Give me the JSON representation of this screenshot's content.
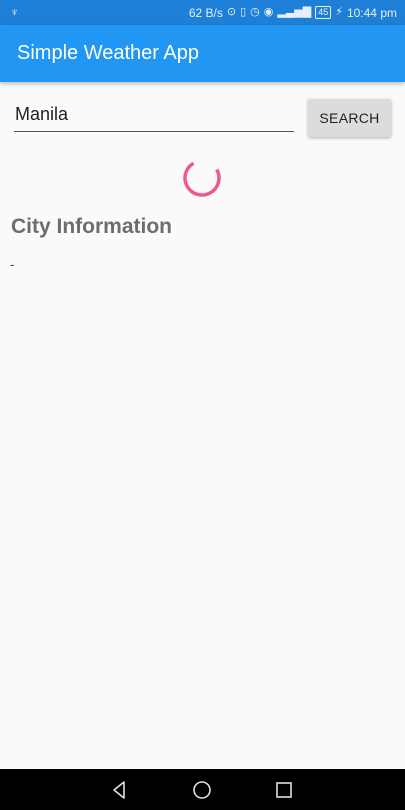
{
  "status_bar": {
    "left_icon": "usb-icon",
    "network_speed": "62 B/s",
    "battery_level": "45",
    "time": "10:44 pm"
  },
  "app_bar": {
    "title": "Simple Weather App",
    "color": "#2196f3"
  },
  "search": {
    "value": "Manila",
    "button_label": "SEARCH"
  },
  "loading": {
    "indicator": "loading-spinner",
    "color": "#f05a85"
  },
  "city_info": {
    "heading": "City Information",
    "value": "-"
  },
  "nav_bar": {
    "buttons": [
      "back-icon",
      "home-icon",
      "recents-icon"
    ]
  }
}
